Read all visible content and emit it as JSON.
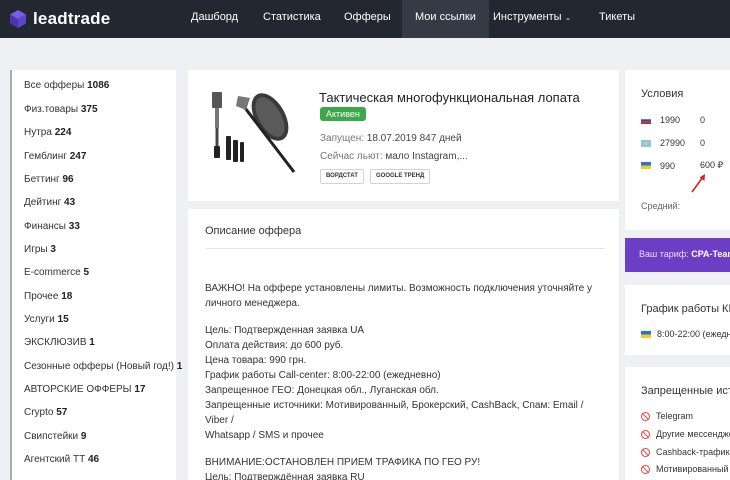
{
  "brand": {
    "name": "leadtrade"
  },
  "nav": {
    "items": [
      {
        "label": "Дашборд"
      },
      {
        "label": "Статистика"
      },
      {
        "label": "Офферы"
      },
      {
        "label": "Мои ссылки"
      },
      {
        "label": "Инструменты"
      },
      {
        "label": "Тикеты"
      }
    ],
    "active": "Мои ссылки"
  },
  "sidebar": {
    "categories": [
      {
        "label": "Все офферы",
        "count": "1086"
      },
      {
        "label": "Физ.товары",
        "count": "375"
      },
      {
        "label": "Нутра",
        "count": "224"
      },
      {
        "label": "Гемблинг",
        "count": "247"
      },
      {
        "label": "Беттинг",
        "count": "96"
      },
      {
        "label": "Дейтинг",
        "count": "43"
      },
      {
        "label": "Финансы",
        "count": "33"
      },
      {
        "label": "Игры",
        "count": "3"
      },
      {
        "label": "E-commerce",
        "count": "5"
      },
      {
        "label": "Прочее",
        "count": "18"
      },
      {
        "label": "Услуги",
        "count": "15"
      },
      {
        "label": "ЭКСКЛЮЗИВ",
        "count": "1"
      },
      {
        "label": "Сезонные офферы (Новый год!)",
        "count": "1"
      },
      {
        "label": "АВТОРСКИЕ ОФФЕРЫ",
        "count": "17"
      },
      {
        "label": "Crypto",
        "count": "57"
      },
      {
        "label": "Свипстейки",
        "count": "9"
      },
      {
        "label": "Агентский ТТ",
        "count": "46"
      }
    ]
  },
  "offer": {
    "title": "Тактическая многофункциональная лопата",
    "status": "Активен",
    "launched_label": "Запущен:",
    "launched_value": "18.07.2019 847 дней",
    "now_label": "Сейчас льют:",
    "now_value": "мало Instagram,...",
    "buttons": {
      "wordstat": "ВОРДСТАТ",
      "google_trend": "GOOGLE ТРЕНД"
    }
  },
  "description": {
    "title": "Описание оффера",
    "lines": [
      "ВАЖНО! На оффере установлены лимиты. Возможность подключения уточняйте у",
      "личного менеджера.",
      "",
      "Цель: Подтвержденная заявка UA",
      "Оплата действия: до 600 руб.",
      "Цена товара: 990 грн.",
      "График работы Call-center: 8:00-22:00 (ежедневно)",
      "Запрещенное ГЕО: Донецкая обл., Луганская обл.",
      "Запрещенные источники: Мотивированный, Брокерский, CashBack, Спам: Email / Viber /",
      "Whatsapp / SMS и прочее",
      "",
      "ВНИМАНИЕ:ОСТАНОВЛЕН ПРИЕМ ТРАФИКА ПО ГЕО РУ!",
      "Цель: Подтверждённая заявка RU"
    ]
  },
  "conditions": {
    "title": "Условия",
    "rows": [
      {
        "flag": "ru-flag",
        "price": "1990",
        "payout": "0"
      },
      {
        "flag": "kz-flag",
        "price": "27990",
        "payout": "0"
      },
      {
        "flag": "ua-flag",
        "price": "990",
        "payout": "600 ₽"
      }
    ],
    "avg_label": "Средний:"
  },
  "tariff": {
    "label": "Ваш тариф:",
    "value": "CPA-Team"
  },
  "schedule": {
    "title": "График работы КЦ",
    "row": "8:00-22:00 (ежедн"
  },
  "sources": {
    "title": "Запрещенные исто",
    "items": [
      "Telegram",
      "Другие мессендже",
      "Cashback-трафик",
      "Мотивированный"
    ]
  },
  "colors": {
    "topbar": "#23272f",
    "active_nav": "#343a46",
    "status_green": "#3ea74b",
    "tariff_purple": "#6c3ec6",
    "ban_red": "#e0413c"
  }
}
